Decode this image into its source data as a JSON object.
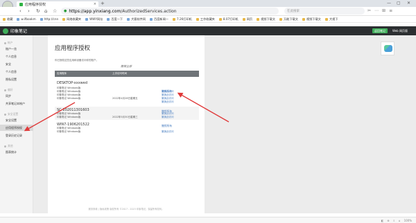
{
  "browser": {
    "tab_title": "应用程序授权",
    "tab_close": "×",
    "new_tab": "+",
    "url_host": "https://app.yinxiang.com",
    "url_path": "/AuthorizedServices.action",
    "search_placeholder": "在此搜索",
    "window_controls": [
      "—",
      "▢",
      "✕"
    ],
    "nav_buttons": [
      "‹",
      "›",
      "↻",
      "⌂",
      "☆"
    ],
    "toolbar_icons": [
      "✂",
      "⋯",
      "⊞",
      "≡"
    ],
    "bookmarks": [
      {
        "label": "收藏",
        "type": "folder"
      },
      {
        "label": "w.ifbookm",
        "type": "site"
      },
      {
        "label": "http://cnn",
        "type": "site"
      },
      {
        "label": "网络收藏夹",
        "type": "folder"
      },
      {
        "label": "WWY网址",
        "type": "site"
      },
      {
        "label": "百度一下",
        "type": "site"
      },
      {
        "label": "大客软件网",
        "type": "site"
      },
      {
        "label": "百度新闻一",
        "type": "site"
      },
      {
        "label": "7.26打印机",
        "type": "folder"
      },
      {
        "label": "工作收藏夹",
        "type": "folder"
      },
      {
        "label": "8.07打印机",
        "type": "folder"
      },
      {
        "label": "网页",
        "type": "folder"
      },
      {
        "label": "视频下载文",
        "type": "folder"
      },
      {
        "label": "万能下载文",
        "type": "folder"
      },
      {
        "label": "视频下载文",
        "type": "folder"
      },
      {
        "label": "大视下",
        "type": "folder"
      }
    ]
  },
  "app": {
    "logo_text": "印象笔记",
    "header_buttons": [
      "返回笔记",
      "Web 网页版"
    ]
  },
  "sidebar": {
    "groups": [
      {
        "title": "帐户",
        "items": [
          "账户一览",
          "个人信息",
          "安全",
          "个人信息",
          "隐私设置"
        ]
      },
      {
        "title": "偏好",
        "items": [
          "同步",
          "共享笔记本帐户"
        ]
      },
      {
        "title": "安全设置",
        "items": [
          "安全设置",
          "应用程序授权",
          "登录历史记录"
        ]
      },
      {
        "title": "其他",
        "items": [
          "图表统计"
        ]
      }
    ],
    "active_item": "应用程序授权"
  },
  "page": {
    "title": "应用程序授权",
    "description": "你已授权这些应用和设备访问你的账户。",
    "revoke_all": "撤销全部",
    "columns": [
      "应用程序",
      "上次访问时间"
    ],
    "devices": [
      {
        "name": "DESKTOP-xxxwed",
        "revoke_label": "撤销所有",
        "sessions": [
          {
            "app": "印象笔记 Windows版",
            "time": "",
            "action": "撤销此访问"
          },
          {
            "app": "印象笔记 Windows版",
            "time": "",
            "action": "撤销此访问"
          },
          {
            "app": "印象笔记 Windows版",
            "time": "",
            "action": "撤销此访问"
          },
          {
            "app": "印象笔记 Windows版",
            "time": "2022年4月28日星期五",
            "action": "撤销此访问"
          }
        ]
      },
      {
        "name": "SC-202011301603",
        "revoke_label": "撤销所有",
        "sessions": [
          {
            "app": "印象笔记 Windows版",
            "time": "",
            "action": "撤销此访问"
          },
          {
            "app": "印象笔记 Windows版",
            "time": "2022年5月30日星期三",
            "action": "撤销此访问"
          }
        ]
      },
      {
        "name": "WIN7-1906201522",
        "revoke_label": "撤销所有",
        "sessions": [
          {
            "app": "印象笔记 Windows版",
            "time": "",
            "action": ""
          },
          {
            "app": "印象笔记 Windows版",
            "time": "",
            "action": "撤销此访问"
          }
        ]
      }
    ],
    "footer": "服务条款  |  隐私政策  版权所有 ©2017 - 2023 印象笔记，保留所有权利。"
  },
  "statusbar": {
    "icons": [
      "◧",
      "⊕",
      "⇩",
      "⌂",
      "100%"
    ]
  },
  "colors": {
    "accent_green": "#3fae5a",
    "header_dark": "#2c2f31",
    "table_header": "#6f7478",
    "link_blue": "#4a7fc1",
    "arrow_red": "#e03a3a"
  }
}
